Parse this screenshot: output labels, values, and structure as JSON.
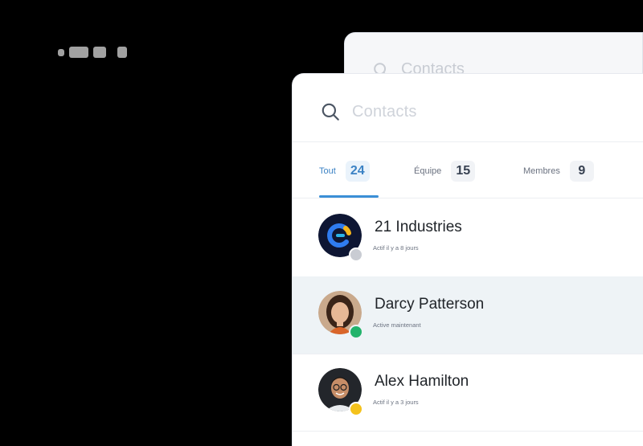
{
  "search": {
    "placeholder": "Contacts",
    "back_placeholder": "Contacts"
  },
  "tabs": [
    {
      "label": "Tout",
      "count": "24",
      "active": true
    },
    {
      "label": "Équipe",
      "count": "15",
      "active": false
    },
    {
      "label": "Membres",
      "count": "9",
      "active": false
    }
  ],
  "contacts": [
    {
      "name": "21 Industries",
      "status": "Actif il y a 8 jours",
      "presence": "offline",
      "avatar": "logo-21-industries"
    },
    {
      "name": "Darcy Patterson",
      "status": "Active maintenant",
      "presence": "online",
      "avatar": "photo-woman"
    },
    {
      "name": "Alex Hamilton",
      "status": "Actif il y a 3 jours",
      "presence": "away",
      "avatar": "photo-man"
    }
  ],
  "colors": {
    "accent": "#3b8fd6",
    "online": "#22b36b",
    "away": "#f4c21c",
    "offline": "#c9ccd3",
    "highlight_row": "#eef3f6"
  },
  "icons": {
    "search": "search-icon"
  }
}
